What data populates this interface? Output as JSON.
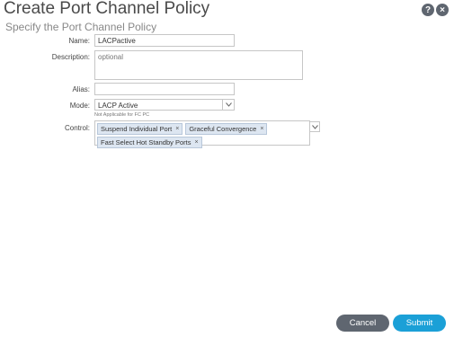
{
  "dialog": {
    "title": "Create Port Channel Policy",
    "subtitle": "Specify the Port Channel Policy",
    "help_icon": "?",
    "close_icon": "×"
  },
  "form": {
    "name_label": "Name:",
    "name_value": "LACPactive",
    "description_label": "Description:",
    "description_placeholder": "optional",
    "alias_label": "Alias:",
    "alias_value": "",
    "mode_label": "Mode:",
    "mode_value": "LACP Active",
    "mode_helper": "Not Applicable for FC PC",
    "control_label": "Control:",
    "control_tags": [
      "Suspend Individual Port",
      "Graceful Convergence",
      "Fast Select Hot Standby Ports"
    ],
    "tag_remove": "×"
  },
  "footer": {
    "cancel_label": "Cancel",
    "submit_label": "Submit"
  },
  "colors": {
    "submit": "#1ba0d7",
    "cancel": "#5f6670",
    "tag_bg": "#dde6f1"
  }
}
